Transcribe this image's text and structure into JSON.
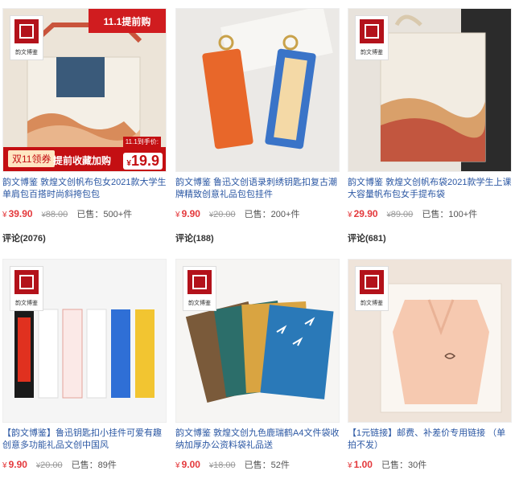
{
  "products": [
    {
      "title": "韵文博鉴 敦煌文创帆布包女2021款大学生单肩包百搭时尚斜挎包包",
      "currency": "¥",
      "price": "39.90",
      "original_price": "88.00",
      "sold": "已售：500+件",
      "comment_label": "评论",
      "comment_count": "(2076)",
      "brand": "韵文博鉴",
      "promo": {
        "top": "11.1提前购",
        "tag": "双11领券",
        "slogan": "提前收藏加购",
        "note": "11.1到手价:",
        "price_symbol": "¥",
        "price": "19.9"
      }
    },
    {
      "title": "韵文博鉴 鲁迅文创语录刺绣钥匙扣复古潮牌精致创意礼品包包挂件",
      "currency": "¥",
      "price": "9.90",
      "original_price": "20.00",
      "sold": "已售：200+件",
      "comment_label": "评论",
      "comment_count": "(188)"
    },
    {
      "title": "韵文博鉴 敦煌文创帆布袋2021款学生上课大容量帆布包女手提布袋",
      "currency": "¥",
      "price": "29.90",
      "original_price": "89.00",
      "sold": "已售：100+件",
      "comment_label": "评论",
      "comment_count": "(681)",
      "brand": "韵文博鉴"
    },
    {
      "title": "【韵文博鉴】鲁迅钥匙扣小挂件可爱有趣创意多功能礼品文创中国风",
      "currency": "¥",
      "price": "9.90",
      "original_price": "20.00",
      "sold": "已售：89件",
      "brand": "韵文博鉴"
    },
    {
      "title": "韵文博鉴 敦煌文创九色鹿瑞鹤A4文件袋收纳加厚办公资料袋礼品送",
      "currency": "¥",
      "price": "9.00",
      "original_price": "18.00",
      "sold": "已售：52件",
      "brand": "韵文博鉴"
    },
    {
      "title": "【1元链接】邮费、补差价专用链接 （单拍不发）",
      "currency": "¥",
      "price": "1.00",
      "sold": "已售：30件",
      "brand": "韵文博鉴"
    }
  ],
  "colors": {
    "link": "#2b57a3",
    "price": "#e4393c",
    "promo_red": "#c40f12"
  }
}
